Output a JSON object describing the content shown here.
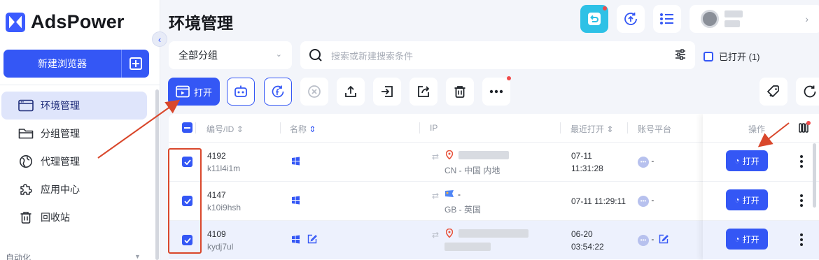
{
  "app": {
    "name": "AdsPower"
  },
  "sidebar": {
    "new_browser_label": "新建浏览器",
    "items": [
      {
        "label": "环境管理",
        "icon": "browser-window-icon",
        "active": true
      },
      {
        "label": "分组管理",
        "icon": "folder-icon",
        "active": false
      },
      {
        "label": "代理管理",
        "icon": "globe-icon",
        "active": false
      },
      {
        "label": "应用中心",
        "icon": "puzzle-icon",
        "active": false
      },
      {
        "label": "回收站",
        "icon": "trash-icon",
        "active": false
      }
    ],
    "automation_label": "自动化"
  },
  "header": {
    "title": "环境管理"
  },
  "filters": {
    "group_select_value": "全部分组",
    "search_placeholder": "搜索或新建搜索条件",
    "opened_only_label": "已打开 (1)"
  },
  "toolbar": {
    "open_label": "打开"
  },
  "table": {
    "columns": {
      "id": "编号/ID",
      "name": "名称",
      "ip": "IP",
      "last_opened": "最近打开",
      "platform": "账号平台",
      "actions": "操作"
    },
    "rows": [
      {
        "number": "4192",
        "id": "k11l4i1m",
        "ip_region": "CN - 中国 内地",
        "last_opened_date": "07-11",
        "last_opened_time": "11:31:28",
        "platform": "-",
        "open_label": "打开",
        "selected": false
      },
      {
        "number": "4147",
        "id": "k10i9hsh",
        "ip_value": "-",
        "ip_region": "GB - 英国",
        "last_opened_date": "07-11 11:29:11",
        "last_opened_time": "",
        "platform": "-",
        "open_label": "打开",
        "selected": false
      },
      {
        "number": "4109",
        "id": "kydj7ul",
        "ip_region": "",
        "last_opened_date": "06-20",
        "last_opened_time": "03:54:22",
        "platform": "-",
        "open_label": "打开",
        "selected": true
      }
    ]
  },
  "colors": {
    "primary": "#3457f5",
    "annotation": "#d9472b",
    "sidebar_active": "#dfe5fb"
  }
}
